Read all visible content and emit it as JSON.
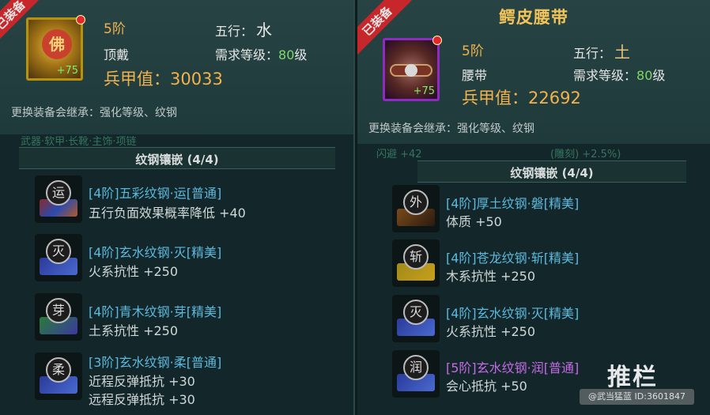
{
  "left": {
    "icon_plus": "+75",
    "icon_glyph": "佛",
    "tier": "5阶",
    "element_label": "五行：",
    "element_value": "水",
    "slot": "顶戴",
    "req_label": "需求等级：",
    "req_level": "80",
    "req_unit": "级",
    "armor_label": "兵甲值：",
    "armor_value": "30033",
    "inherit_note": "更换装备会继承：强化等级、纹钢",
    "corner_tag": "已装备",
    "ghost_line": "武器·软甲·长靴·主饰·项链",
    "section_title": "纹钢镶嵌 (4/4)",
    "gems": [
      {
        "glyph": "运",
        "title": "[4阶]五彩纹钢·运[普通]",
        "stats": [
          "五行负面效果概率降低 +40"
        ]
      },
      {
        "glyph": "灭",
        "title": "[4阶]玄水纹钢·灭[精美]",
        "stats": [
          "火系抗性 +250"
        ]
      },
      {
        "glyph": "芽",
        "title": "[4阶]青木纹钢·芽[精美]",
        "stats": [
          "土系抗性 +250"
        ]
      },
      {
        "glyph": "柔",
        "title": "[3阶]玄水纹钢·柔[普通]",
        "stats": [
          "近程反弹抵抗 +30",
          "远程反弹抵抗 +30"
        ]
      }
    ]
  },
  "right": {
    "title": "鳄皮腰带",
    "corner_tag": "已装备",
    "icon_plus": "+75",
    "tier": "5阶",
    "element_label": "五行：",
    "element_value": "土",
    "slot": "腰带",
    "req_label": "需求等级：",
    "req_level": "80",
    "req_unit": "级",
    "armor_label": "兵甲值：",
    "armor_value": "22692",
    "inherit_note": "更换装备会继承：强化等级、纹钢",
    "ghost_line_left": "闪避 +42",
    "ghost_line_right": "(雕刻) +2.5%)",
    "section_title": "纹钢镶嵌 (4/4)",
    "gems": [
      {
        "glyph": "外",
        "title": "[4阶]厚土纹钢·磐[精美]",
        "stats": [
          "体质 +50"
        ]
      },
      {
        "glyph": "斩",
        "title": "[4阶]苍龙纹钢·斩[精美]",
        "stats": [
          "木系抗性 +250"
        ]
      },
      {
        "glyph": "灭",
        "title": "[4阶]玄水纹钢·灭[精美]",
        "stats": [
          "火系抗性 +250"
        ]
      },
      {
        "glyph": "润",
        "title": "[5阶]玄水纹钢·润[普通]",
        "stats": [
          "会心抵抗 +50"
        ]
      }
    ]
  },
  "watermark": {
    "text": "推栏",
    "id": "@武当猛蓝 ID:3601847"
  },
  "colors": {
    "gold": "#f2b24e",
    "green": "#7fd86a",
    "blue": "#5cb9dd",
    "purple": "#c56be6",
    "tag_red": "#c7262a"
  }
}
